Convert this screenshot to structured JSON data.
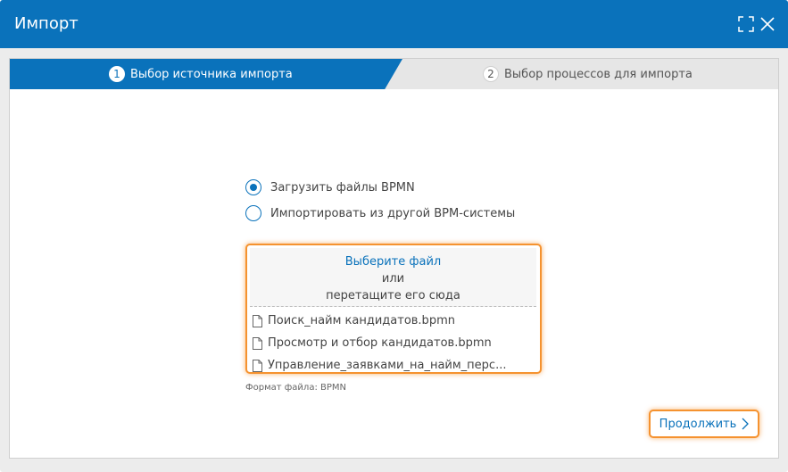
{
  "window": {
    "title": "Импорт",
    "title_bar_color": "#0a72bb",
    "accent_color": "#0a72bb",
    "highlight_color": "#f5922f"
  },
  "steps": [
    {
      "number": "1",
      "label": "Выбор источника импорта",
      "active": true
    },
    {
      "number": "2",
      "label": "Выбор процессов для импорта",
      "active": false
    }
  ],
  "source_options": [
    {
      "label": "Загрузить файлы BPMN",
      "selected": true
    },
    {
      "label": "Импортировать из другой BPM-системы",
      "selected": false
    }
  ],
  "upload": {
    "choose_file": "Выберите файл",
    "or": "или",
    "drag_here": "перетащите его сюда",
    "file_icon": "file-icon",
    "files": [
      "Поиск_найм кандидатов.bpmn",
      "Просмотр и отбор кандидатов.bpmn",
      "Управление_заявками_на_найм_перс..."
    ]
  },
  "format_hint": "Формат файла: BPMN",
  "continue_button": {
    "label": "Продолжить",
    "icon": "chevron-right-icon"
  },
  "window_controls": {
    "maximize_icon": "maximize-icon",
    "close_icon": "close-icon"
  }
}
